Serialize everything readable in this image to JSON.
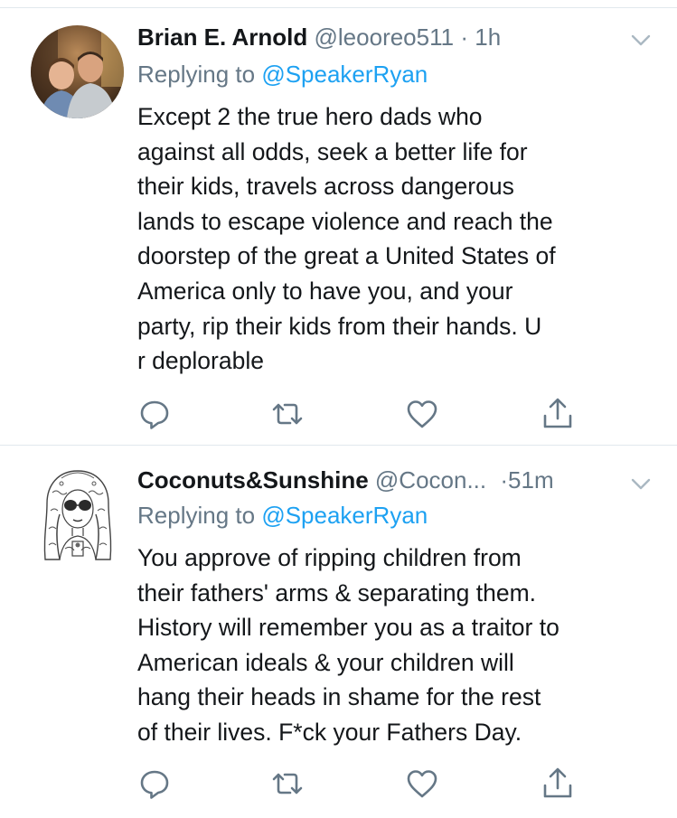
{
  "tweets": [
    {
      "name": "Brian E. Arnold",
      "handle": "@leooreo511",
      "separator": "·",
      "time": "1h",
      "replying_prefix": "Replying to",
      "replying_to": "@SpeakerRyan",
      "text_lines": [
        "Except 2 the true hero dads who",
        "against all odds, seek a better life for",
        "their kids, travels across dangerous",
        "lands to escape violence and reach the",
        "doorstep of the great a United States of",
        "America only to have you, and your",
        "party, rip their kids from their hands. U",
        "r deplorable"
      ],
      "avatar": "photo-avatar"
    },
    {
      "name": "Coconuts&Sunshine",
      "handle": "@Cocon...",
      "separator": "·",
      "time": "51m",
      "replying_prefix": "Replying to",
      "replying_to": "@SpeakerRyan",
      "text_lines": [
        "You approve of ripping children from",
        "their fathers' arms & separating them.",
        "History will remember you as a traitor to",
        "American ideals & your children will",
        "hang their heads in shame for the rest",
        "of their lives. F*ck your Fathers Day."
      ],
      "avatar": "sketch-avatar"
    }
  ],
  "icons": {
    "reply": "reply-icon",
    "retweet": "retweet-icon",
    "like": "heart-icon",
    "share": "share-icon",
    "menu": "chevron-down-icon"
  },
  "colors": {
    "text": "#14171a",
    "muted": "#657786",
    "link": "#1da1f2",
    "divider": "#e1e8ed",
    "icon": "#657786"
  }
}
